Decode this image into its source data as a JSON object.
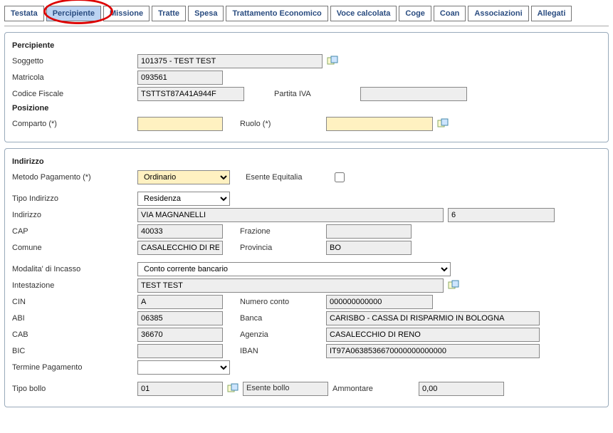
{
  "tabs": {
    "testata": "Testata",
    "percipiente": "Percipiente",
    "missione": "Missione",
    "tratte": "Tratte",
    "spesa": "Spesa",
    "trattamento": "Trattamento Economico",
    "voce": "Voce calcolata",
    "coge": "Coge",
    "coan": "Coan",
    "assoc": "Associazioni",
    "allegati": "Allegati"
  },
  "percipiente": {
    "title": "Percipiente",
    "soggetto_lbl": "Soggetto",
    "soggetto_val": "101375 - TEST TEST",
    "matricola_lbl": "Matricola",
    "matricola_val": "093561",
    "cf_lbl": "Codice Fiscale",
    "cf_val": "TSTTST87A41A944F",
    "piva_lbl": "Partita IVA",
    "piva_val": ""
  },
  "posizione": {
    "title": "Posizione",
    "comparto_lbl": "Comparto (*)",
    "comparto_val": "",
    "ruolo_lbl": "Ruolo (*)",
    "ruolo_val": ""
  },
  "indirizzo": {
    "title": "Indirizzo",
    "metodo_lbl": "Metodo Pagamento (*)",
    "metodo_val": "Ordinario",
    "esente_eq_lbl": "Esente Equitalia",
    "tipo_ind_lbl": "Tipo Indirizzo",
    "tipo_ind_val": "Residenza",
    "ind_lbl": "Indirizzo",
    "ind_val": "VIA MAGNANELLI",
    "civico_val": "6",
    "cap_lbl": "CAP",
    "cap_val": "40033",
    "frazione_lbl": "Frazione",
    "frazione_val": "",
    "comune_lbl": "Comune",
    "comune_val": "CASALECCHIO DI RENO",
    "provincia_lbl": "Provincia",
    "provincia_val": "BO",
    "modalita_lbl": "Modalita' di Incasso",
    "modalita_val": "Conto corrente bancario",
    "intest_lbl": "Intestazione",
    "intest_val": "TEST TEST",
    "cin_lbl": "CIN",
    "cin_val": "A",
    "numconto_lbl": "Numero conto",
    "numconto_val": "000000000000",
    "abi_lbl": "ABI",
    "abi_val": "06385",
    "banca_lbl": "Banca",
    "banca_val": "CARISBO - CASSA DI RISPARMIO IN BOLOGNA",
    "cab_lbl": "CAB",
    "cab_val": "36670",
    "agenzia_lbl": "Agenzia",
    "agenzia_val": "CASALECCHIO DI RENO",
    "bic_lbl": "BIC",
    "bic_val": "",
    "iban_lbl": "IBAN",
    "iban_val": "IT97A0638536670000000000000",
    "termine_lbl": "Termine Pagamento",
    "termine_val": "",
    "tipobollo_lbl": "Tipo bollo",
    "tipobollo_val": "01",
    "esentebollo_lbl": "Esente bollo",
    "ammontare_lbl": "Ammontare",
    "ammontare_val": "0,00"
  }
}
